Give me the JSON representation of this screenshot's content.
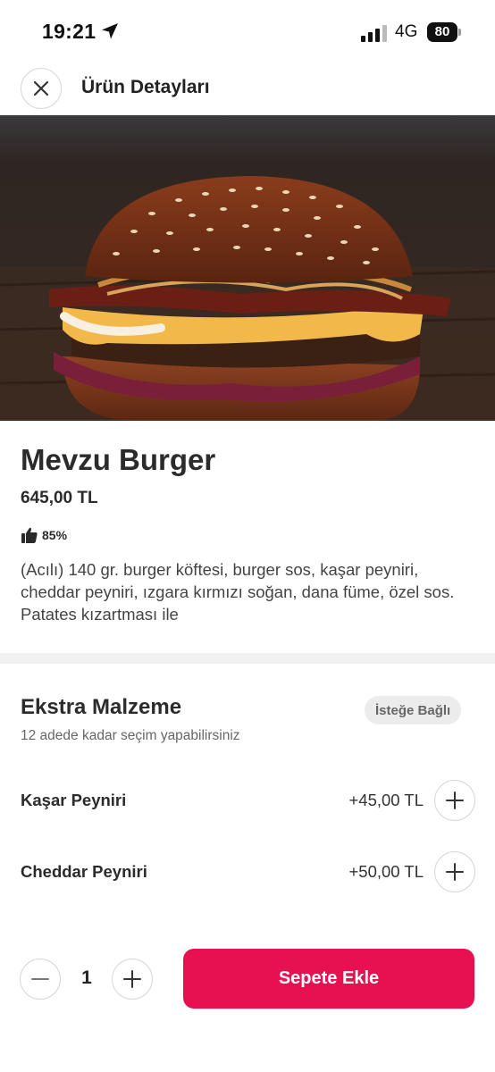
{
  "status": {
    "time": "19:21",
    "network": "4G",
    "battery": "80"
  },
  "header": {
    "title": "Ürün Detayları"
  },
  "product": {
    "name": "Mevzu Burger",
    "price": "645,00 TL",
    "rating": "85%",
    "description": "(Acılı) 140 gr. burger köftesi, burger sos, kaşar peyniri, cheddar peyniri, ızgara kırmızı soğan, dana füme, özel sos. Patates kızartması ile"
  },
  "extras": {
    "title": "Ekstra Malzeme",
    "badge": "İsteğe Bağlı",
    "subtitle": "12 adede kadar seçim yapabilirsiniz",
    "items": [
      {
        "name": "Kaşar Peyniri",
        "price": "+45,00 TL"
      },
      {
        "name": "Cheddar Peyniri",
        "price": "+50,00 TL"
      }
    ]
  },
  "cart": {
    "quantity": "1",
    "add_label": "Sepete Ekle"
  },
  "colors": {
    "accent": "#e8114f",
    "text": "#2b2b2b",
    "muted": "#666666"
  },
  "icons": [
    "location-arrow-icon",
    "signal-icon",
    "battery-icon",
    "close-icon",
    "thumbs-up-icon",
    "plus-icon",
    "minus-icon"
  ]
}
